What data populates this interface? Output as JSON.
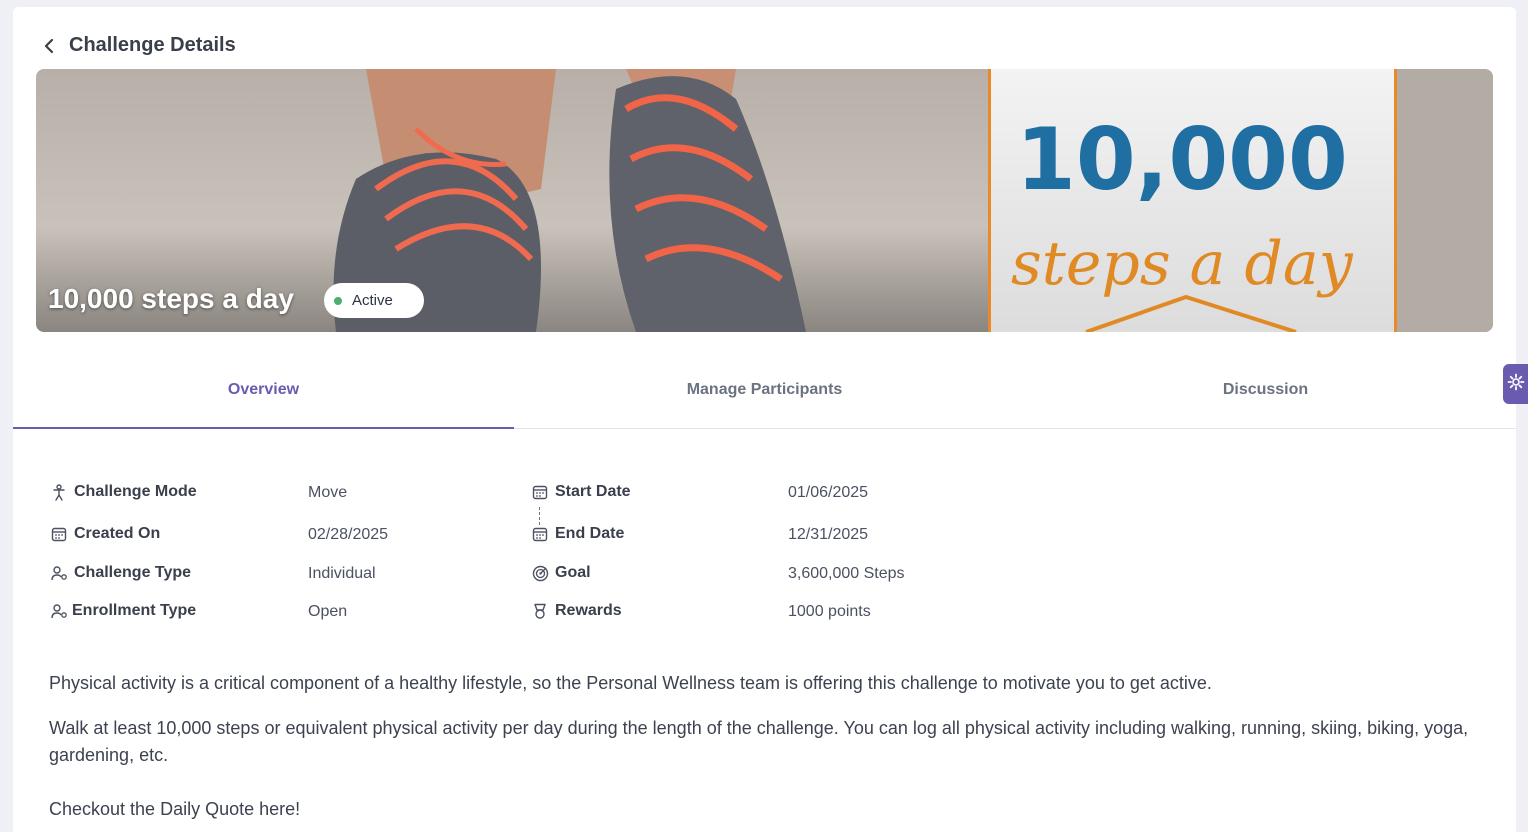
{
  "header": {
    "title": "Challenge Details",
    "back_icon": "chevron-left-icon"
  },
  "banner": {
    "title": "10,000 steps a day",
    "status": "Active",
    "status_color": "#4caf6e",
    "image_text_number": "10,000",
    "image_text_script": "steps a day"
  },
  "tabs": [
    {
      "label": "Overview",
      "active": true
    },
    {
      "label": "Manage Participants",
      "active": false
    },
    {
      "label": "Discussion",
      "active": false
    }
  ],
  "details": {
    "left": [
      {
        "icon": "walking-person-icon",
        "label": "Challenge Mode",
        "value": "Move"
      },
      {
        "icon": "calendar-icon",
        "label": "Created On",
        "value": "02/28/2025"
      },
      {
        "icon": "users-gear-icon",
        "label": "Challenge Type",
        "value": "Individual"
      },
      {
        "icon": "users-gear-icon",
        "label": "Enrollment Type",
        "value": "Open"
      }
    ],
    "right": [
      {
        "icon": "calendar-icon",
        "label": "Start Date",
        "value": "01/06/2025"
      },
      {
        "icon": "calendar-icon",
        "label": "End Date",
        "value": "12/31/2025"
      },
      {
        "icon": "target-icon",
        "label": "Goal",
        "value": "3,600,000 Steps"
      },
      {
        "icon": "trophy-icon",
        "label": "Rewards",
        "value": "1000 points"
      }
    ]
  },
  "description": {
    "p1": "Physical activity is a critical component of a healthy lifestyle, so the Personal Wellness team is offering this challenge to motivate you to get active.",
    "p2": "Walk at least 10,000 steps or equivalent physical activity per day during the length of the challenge. You can log all physical activity including walking, running, skiing, biking, yoga, gardening, etc.",
    "p3": "Checkout the Daily Quote here!"
  },
  "colors": {
    "accent": "#6a5bb0",
    "active_dot": "#4caf6e"
  }
}
